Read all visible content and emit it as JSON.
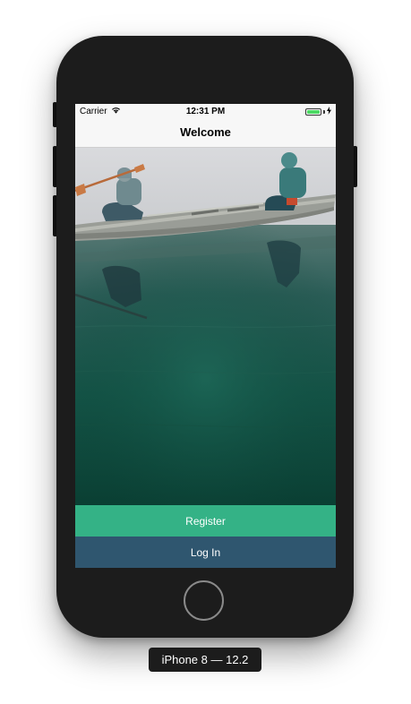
{
  "status_bar": {
    "carrier": "Carrier",
    "time": "12:31 PM",
    "wifi_icon": "wifi-icon",
    "battery_icon": "battery-icon",
    "charging_icon": "bolt-icon"
  },
  "nav": {
    "title": "Welcome"
  },
  "hero": {
    "image_description": "canoe-lake-photo"
  },
  "actions": {
    "register_label": "Register",
    "login_label": "Log In"
  },
  "device": {
    "label": "iPhone 8 — 12.2"
  },
  "colors": {
    "register": "#34b286",
    "login": "#2f566f",
    "phone_body": "#1c1c1c",
    "battery": "#4cd964"
  }
}
